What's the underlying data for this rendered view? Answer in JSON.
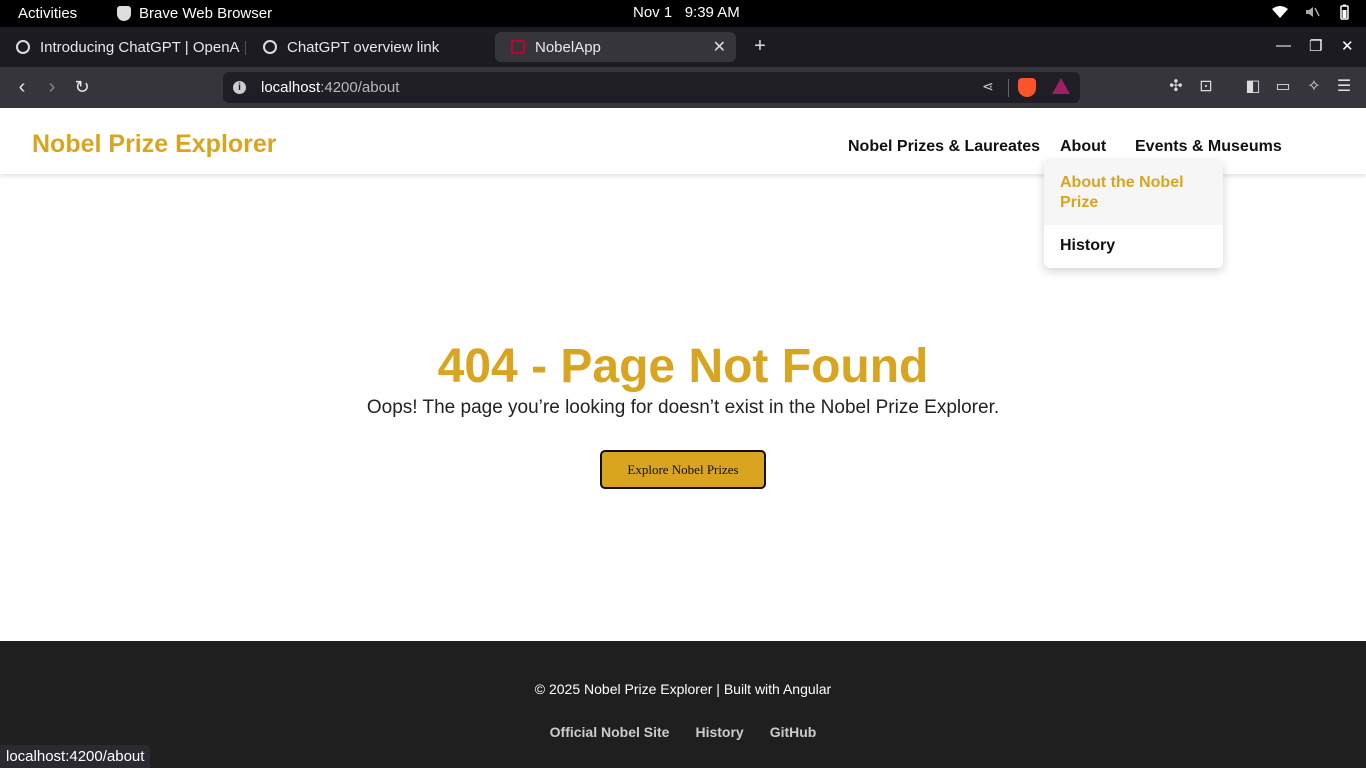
{
  "os_bar": {
    "activities": "Activities",
    "app_name": "Brave Web Browser",
    "date": "Nov 1",
    "time": "9:39 AM"
  },
  "tabs": [
    {
      "title": "Introducing ChatGPT | OpenA",
      "active": false
    },
    {
      "title": "ChatGPT overview link",
      "active": false
    },
    {
      "title": "NobelApp",
      "active": true
    }
  ],
  "toolbar": {
    "url_host": "localhost",
    "url_path": ":4200/about"
  },
  "app": {
    "brand": "Nobel Prize Explorer",
    "nav": {
      "prizes": "Nobel Prizes & Laureates",
      "about": "About",
      "events": "Events & Museums"
    },
    "dropdown": {
      "about_nobel": "About the Nobel Prize",
      "history": "History"
    },
    "error": {
      "title": "404 - Page Not Found",
      "message": "Oops! The page you’re looking for doesn’t exist in the Nobel Prize Explorer.",
      "button": "Explore Nobel Prizes"
    },
    "footer": {
      "copyright": "© 2025 Nobel Prize Explorer | Built with Angular",
      "links": [
        "Official Nobel Site",
        "History",
        "GitHub"
      ]
    }
  },
  "status_bar": "localhost:4200/about",
  "colors": {
    "brand_gold": "#d9a521",
    "footer_bg": "#1f1f1f"
  }
}
